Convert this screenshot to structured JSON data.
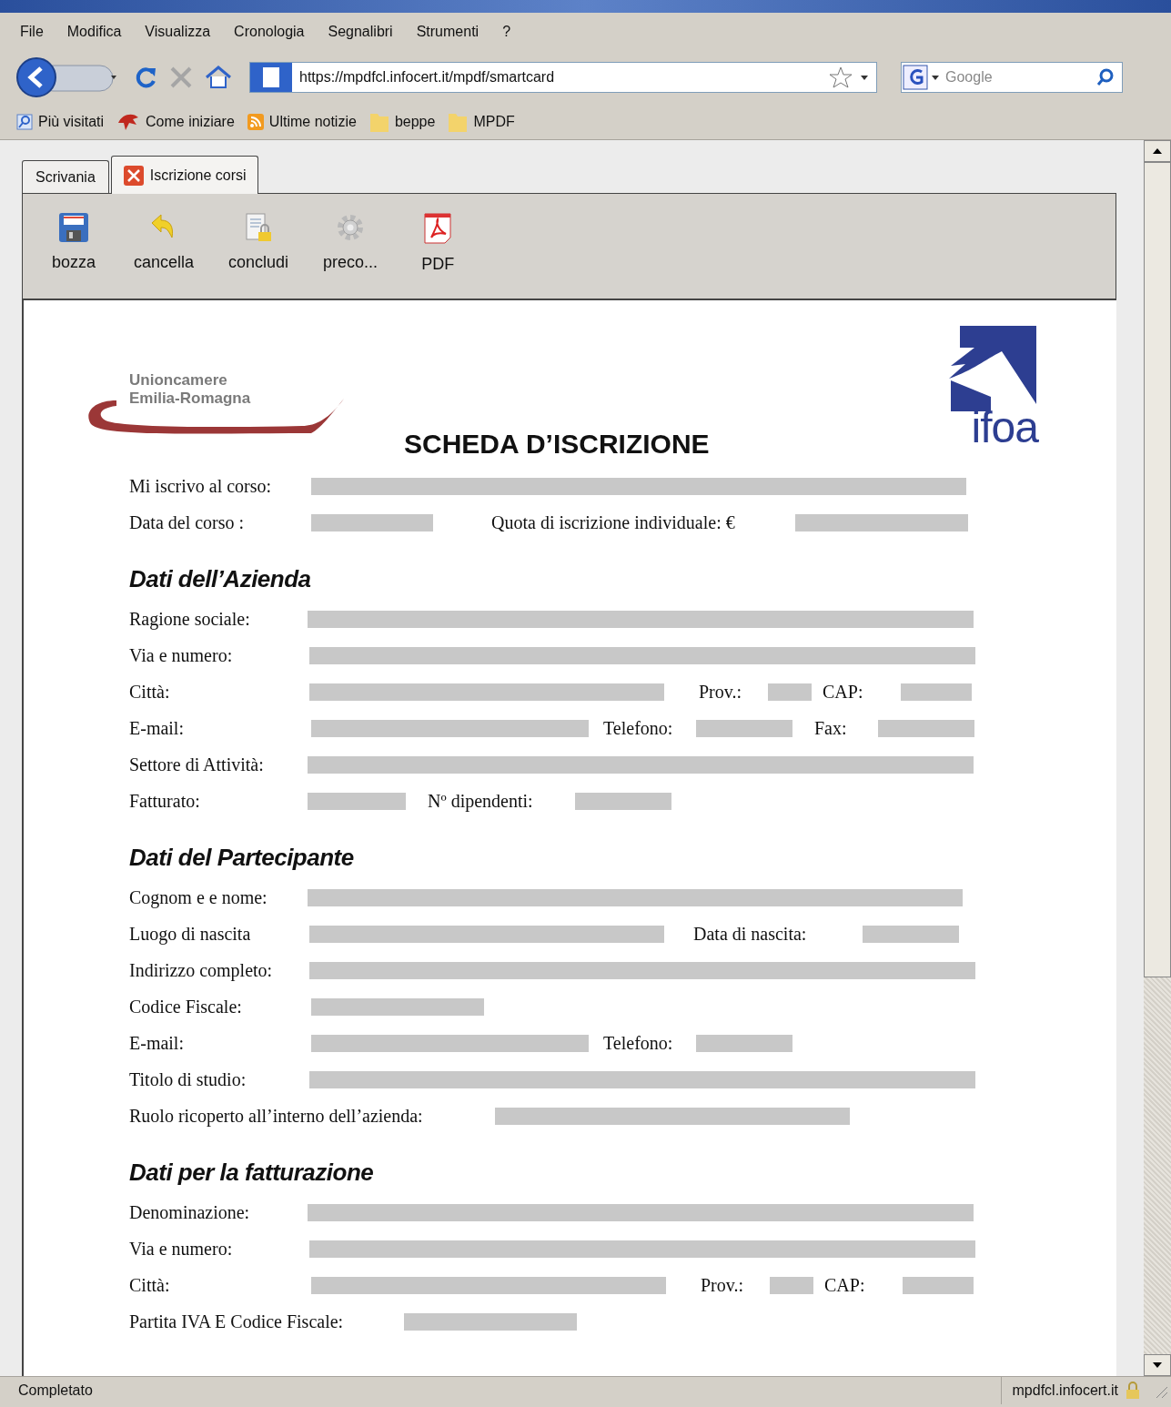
{
  "menu": [
    "File",
    "Modifica",
    "Visualizza",
    "Cronologia",
    "Segnalibri",
    "Strumenti",
    "?"
  ],
  "address": "https://mpdfcl.infocert.it/mpdf/smartcard",
  "search": {
    "placeholder": "Google"
  },
  "bookmarks": [
    {
      "kind": "search",
      "label": "Più visitati"
    },
    {
      "kind": "bird",
      "label": "Come iniziare"
    },
    {
      "kind": "feed",
      "label": "Ultime notizie"
    },
    {
      "kind": "folder",
      "label": "beppe"
    },
    {
      "kind": "folder",
      "label": "MPDF"
    }
  ],
  "tabs": [
    {
      "label": "Scrivania",
      "selected": false,
      "closable": false
    },
    {
      "label": "Iscrizione corsi",
      "selected": true,
      "closable": true
    }
  ],
  "toolbar": [
    {
      "kind": "save",
      "label": "bozza"
    },
    {
      "kind": "undo",
      "label": "cancella"
    },
    {
      "kind": "finish",
      "label": "concludi"
    },
    {
      "kind": "gear",
      "label": "preco..."
    },
    {
      "kind": "pdf",
      "label": "PDF"
    }
  ],
  "document": {
    "logo_left": [
      "Unioncamere",
      "Emilia-Romagna"
    ],
    "logo_right": "ifoa",
    "title": "SCHEDA D’ISCRIZIONE",
    "sections": [
      {
        "rows": [
          {
            "parts": [
              {
                "kind": "label",
                "text": "Mi iscrivo al corso:"
              },
              {
                "kind": "field"
              }
            ]
          },
          {
            "parts": [
              {
                "kind": "label",
                "text": "Data del corso :"
              },
              {
                "kind": "field"
              },
              {
                "kind": "label",
                "text": "Quota di iscrizione individuale: €"
              },
              {
                "kind": "field"
              }
            ]
          }
        ]
      },
      {
        "heading": "Dati dell’Azienda",
        "rows": [
          {
            "parts": [
              {
                "kind": "label",
                "text": "Ragione sociale:"
              },
              {
                "kind": "field"
              }
            ]
          },
          {
            "parts": [
              {
                "kind": "label",
                "text": "Via e numero:"
              },
              {
                "kind": "field"
              }
            ]
          },
          {
            "parts": [
              {
                "kind": "label",
                "text": "Città:"
              },
              {
                "kind": "field"
              },
              {
                "kind": "label",
                "text": "Prov.:"
              },
              {
                "kind": "field"
              },
              {
                "kind": "label",
                "text": "CAP:"
              },
              {
                "kind": "field"
              }
            ]
          },
          {
            "parts": [
              {
                "kind": "label",
                "text": "E-mail:"
              },
              {
                "kind": "field"
              },
              {
                "kind": "label",
                "text": "Telefono:"
              },
              {
                "kind": "field"
              },
              {
                "kind": "label",
                "text": "Fax:"
              },
              {
                "kind": "field"
              }
            ]
          },
          {
            "parts": [
              {
                "kind": "label",
                "text": "Settore di Attività:"
              },
              {
                "kind": "field"
              }
            ]
          },
          {
            "parts": [
              {
                "kind": "label",
                "text": "Fatturato:"
              },
              {
                "kind": "field"
              },
              {
                "kind": "label",
                "text": "Nº dipendenti:"
              },
              {
                "kind": "field"
              }
            ]
          }
        ]
      },
      {
        "heading": "Dati del Partecipante",
        "rows": [
          {
            "parts": [
              {
                "kind": "label",
                "text": "Cognom e e nome:"
              },
              {
                "kind": "field"
              }
            ]
          },
          {
            "parts": [
              {
                "kind": "label",
                "text": "Luogo di nascita"
              },
              {
                "kind": "field"
              },
              {
                "kind": "label",
                "text": "Data di nascita:"
              },
              {
                "kind": "field"
              }
            ]
          },
          {
            "parts": [
              {
                "kind": "label",
                "text": "Indirizzo completo:"
              },
              {
                "kind": "field"
              }
            ]
          },
          {
            "parts": [
              {
                "kind": "label",
                "text": "Codice Fiscale:"
              },
              {
                "kind": "field"
              }
            ]
          },
          {
            "parts": [
              {
                "kind": "label",
                "text": "E-mail:"
              },
              {
                "kind": "field"
              },
              {
                "kind": "label",
                "text": "Telefono:"
              },
              {
                "kind": "field"
              }
            ]
          },
          {
            "parts": [
              {
                "kind": "label",
                "text": "Titolo di studio:"
              },
              {
                "kind": "field"
              }
            ]
          },
          {
            "parts": [
              {
                "kind": "label",
                "text": "Ruolo ricoperto all’interno dell’azienda:"
              },
              {
                "kind": "field"
              }
            ]
          }
        ]
      },
      {
        "heading": "Dati per la fatturazione",
        "rows": [
          {
            "parts": [
              {
                "kind": "label",
                "text": "Denominazione:"
              },
              {
                "kind": "field"
              }
            ]
          },
          {
            "parts": [
              {
                "kind": "label",
                "text": "Via e numero:"
              },
              {
                "kind": "field"
              }
            ]
          },
          {
            "parts": [
              {
                "kind": "label",
                "text": "Città:"
              },
              {
                "kind": "field"
              },
              {
                "kind": "label",
                "text": "Prov.:"
              },
              {
                "kind": "field"
              },
              {
                "kind": "label",
                "text": "CAP:"
              },
              {
                "kind": "field"
              }
            ]
          },
          {
            "parts": [
              {
                "kind": "label",
                "text": "Partita IVA E Codice Fiscale:"
              },
              {
                "kind": "field"
              }
            ]
          }
        ]
      }
    ]
  },
  "status": {
    "text": "Completato",
    "host": "mpdfcl.infocert.it"
  }
}
